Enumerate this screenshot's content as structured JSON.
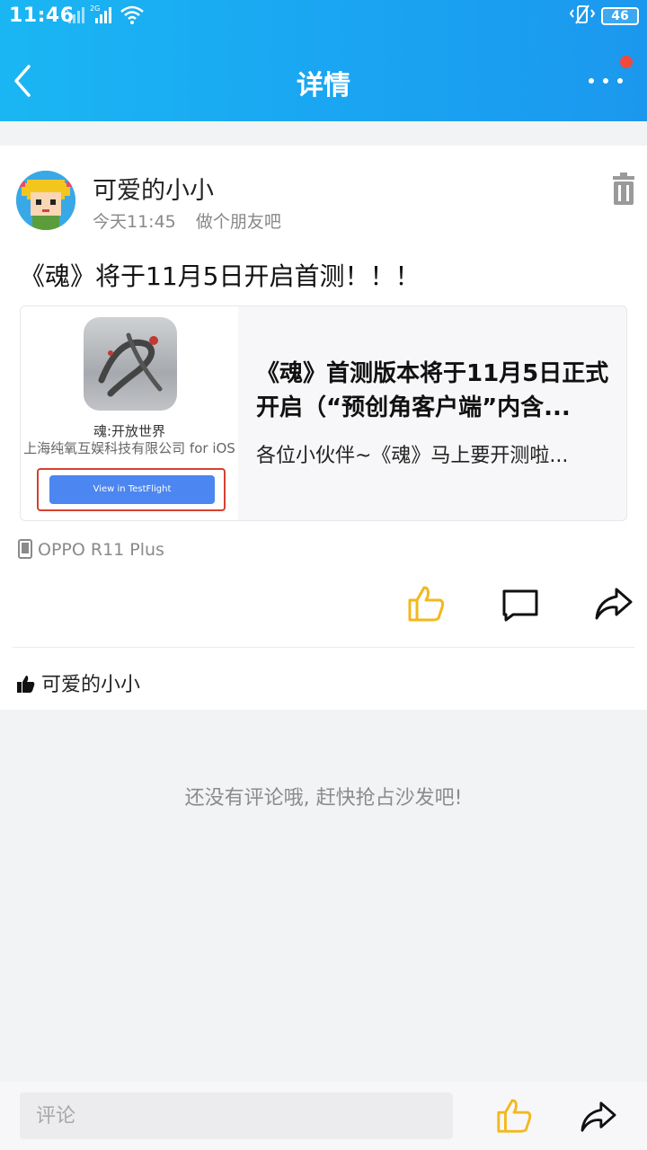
{
  "status_bar": {
    "time": "11:46",
    "battery": "46"
  },
  "app_bar": {
    "title": "详情"
  },
  "post": {
    "username": "可爱的小小",
    "time": "今天11:45",
    "mood": "做个朋友吧",
    "text": "《魂》将于11月5日开启首测！！！",
    "link": {
      "app_name": "魂:开放世界",
      "company": "上海纯氧互娱科技有限公司 for iOS",
      "button_label": "View in TestFlight",
      "title": "《魂》首测版本将于11月5日正式开启（“预创角客户端”内含...",
      "desc": "各位小伙伴~《魂》马上要开测啦..."
    },
    "device": "OPPO R11 Plus",
    "liked_by": "可爱的小小"
  },
  "comments": {
    "empty_text": "还没有评论哦, 赶快抢占沙发吧!"
  },
  "bottom_bar": {
    "placeholder": "评论"
  },
  "colors": {
    "header_start": "#1ab6f3",
    "header_end": "#1b98ee",
    "like_yellow": "#f3b81a",
    "notify_red": "#ef4a3c"
  }
}
